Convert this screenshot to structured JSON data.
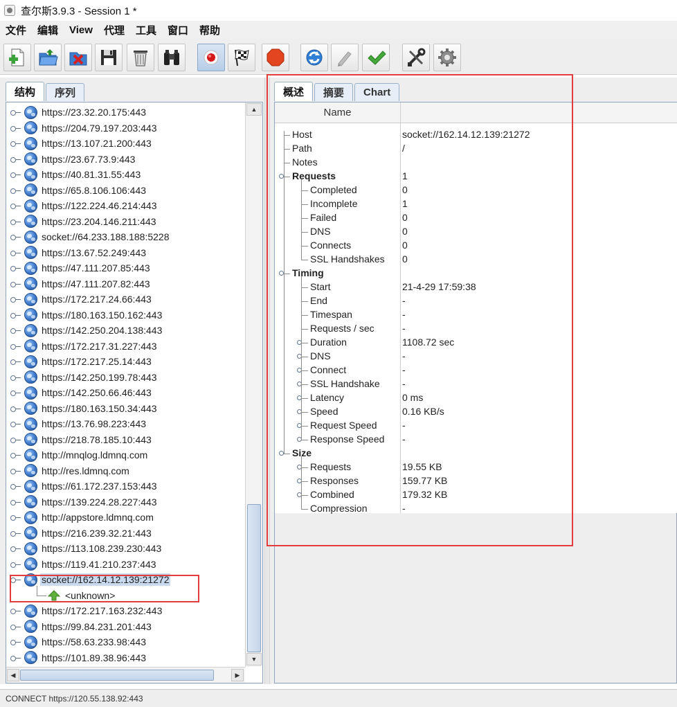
{
  "window": {
    "title": "查尔斯3.9.3 - Session 1 *"
  },
  "menu": [
    "文件",
    "编辑",
    "View",
    "代理",
    "工具",
    "窗口",
    "帮助"
  ],
  "toolbar": {
    "buttons": [
      {
        "name": "new-session-button",
        "icon": "new-session-icon"
      },
      {
        "name": "open-session-button",
        "icon": "open-folder-icon"
      },
      {
        "name": "close-session-button",
        "icon": "close-session-icon"
      },
      {
        "name": "save-session-button",
        "icon": "floppy-disk-icon"
      },
      {
        "name": "clear-session-button",
        "icon": "trash-icon"
      },
      {
        "name": "find-button",
        "icon": "binoculars-icon"
      },
      {
        "name": "record-button",
        "icon": "record-icon",
        "active": true
      },
      {
        "name": "throttle-button",
        "icon": "checkered-flag-icon"
      },
      {
        "name": "stop-button",
        "icon": "stop-sign-icon"
      },
      {
        "name": "repeat-button",
        "icon": "refresh-icon"
      },
      {
        "name": "edit-button",
        "icon": "pencil-icon"
      },
      {
        "name": "validate-button",
        "icon": "checkmark-icon"
      },
      {
        "name": "tools-button",
        "icon": "tools-icon"
      },
      {
        "name": "settings-button",
        "icon": "gear-icon"
      }
    ]
  },
  "left": {
    "tabs": [
      "结构",
      "序列"
    ],
    "selected_tab": "结构",
    "hosts": [
      "https://23.32.20.175:443",
      "https://204.79.197.203:443",
      "https://13.107.21.200:443",
      "https://23.67.73.9:443",
      "https://40.81.31.55:443",
      "https://65.8.106.106:443",
      "https://122.224.46.214:443",
      "https://23.204.146.211:443",
      "socket://64.233.188.188:5228",
      "https://13.67.52.249:443",
      "https://47.111.207.85:443",
      "https://47.111.207.82:443",
      "https://172.217.24.66:443",
      "https://180.163.150.162:443",
      "https://142.250.204.138:443",
      "https://172.217.31.227:443",
      "https://172.217.25.14:443",
      "https://142.250.199.78:443",
      "https://142.250.66.46:443",
      "https://180.163.150.34:443",
      "https://13.76.98.223:443",
      "https://218.78.185.10:443",
      "http://mnqlog.ldmnq.com",
      "http://res.ldmnq.com",
      "https://61.172.237.153:443",
      "https://139.224.28.227:443",
      "http://appstore.ldmnq.com",
      "https://216.239.32.21:443",
      "https://113.108.239.230:443",
      "https://119.41.210.237:443",
      "socket://162.14.12.139:21272",
      "https://172.217.163.232:443",
      "https://99.84.231.201:443",
      "https://58.63.233.98:443",
      "https://101.89.38.96:443"
    ],
    "selected_host": "socket://162.14.12.139:21272",
    "selected_child": "<unknown>"
  },
  "right": {
    "tabs": [
      "概述",
      "摘要",
      "Chart"
    ],
    "selected_tab": "概述",
    "column_header": "Name",
    "rows": [
      {
        "label": "Host",
        "value": "socket://162.14.12.139:21272",
        "level": 0,
        "bold": false,
        "expandable": false
      },
      {
        "label": "Path",
        "value": "/",
        "level": 0,
        "bold": false,
        "expandable": false
      },
      {
        "label": "Notes",
        "value": "",
        "level": 0,
        "bold": false,
        "expandable": false
      },
      {
        "label": "Requests",
        "value": "1",
        "level": 0,
        "bold": true,
        "expandable": true
      },
      {
        "label": "Completed",
        "value": "0",
        "level": 1,
        "bold": false,
        "expandable": false
      },
      {
        "label": "Incomplete",
        "value": "1",
        "level": 1,
        "bold": false,
        "expandable": false
      },
      {
        "label": "Failed",
        "value": "0",
        "level": 1,
        "bold": false,
        "expandable": false
      },
      {
        "label": "DNS",
        "value": "0",
        "level": 1,
        "bold": false,
        "expandable": false
      },
      {
        "label": "Connects",
        "value": "0",
        "level": 1,
        "bold": false,
        "expandable": false
      },
      {
        "label": "SSL Handshakes",
        "value": "0",
        "level": 1,
        "bold": false,
        "expandable": false
      },
      {
        "label": "Timing",
        "value": "",
        "level": 0,
        "bold": true,
        "expandable": true
      },
      {
        "label": "Start",
        "value": "21-4-29 17:59:38",
        "level": 1,
        "bold": false,
        "expandable": false
      },
      {
        "label": "End",
        "value": "-",
        "level": 1,
        "bold": false,
        "expandable": false
      },
      {
        "label": "Timespan",
        "value": "-",
        "level": 1,
        "bold": false,
        "expandable": false
      },
      {
        "label": "Requests / sec",
        "value": "-",
        "level": 1,
        "bold": false,
        "expandable": false
      },
      {
        "label": "Duration",
        "value": "1108.72 sec",
        "level": 1,
        "bold": false,
        "expandable": true
      },
      {
        "label": "DNS",
        "value": "-",
        "level": 1,
        "bold": false,
        "expandable": true
      },
      {
        "label": "Connect",
        "value": "-",
        "level": 1,
        "bold": false,
        "expandable": true
      },
      {
        "label": "SSL Handshake",
        "value": "-",
        "level": 1,
        "bold": false,
        "expandable": true
      },
      {
        "label": "Latency",
        "value": "0 ms",
        "level": 1,
        "bold": false,
        "expandable": true
      },
      {
        "label": "Speed",
        "value": "0.16 KB/s",
        "level": 1,
        "bold": false,
        "expandable": true
      },
      {
        "label": "Request Speed",
        "value": "-",
        "level": 1,
        "bold": false,
        "expandable": true
      },
      {
        "label": "Response Speed",
        "value": "-",
        "level": 1,
        "bold": false,
        "expandable": true
      },
      {
        "label": "Size",
        "value": "",
        "level": 0,
        "bold": true,
        "expandable": true
      },
      {
        "label": "Requests",
        "value": "19.55 KB",
        "level": 1,
        "bold": false,
        "expandable": true
      },
      {
        "label": "Responses",
        "value": "159.77 KB",
        "level": 1,
        "bold": false,
        "expandable": true
      },
      {
        "label": "Combined",
        "value": "179.32 KB",
        "level": 1,
        "bold": false,
        "expandable": true
      },
      {
        "label": "Compression",
        "value": "-",
        "level": 1,
        "bold": false,
        "expandable": false
      }
    ]
  },
  "status": {
    "text": "CONNECT https://120.55.138.92:443"
  },
  "colors": {
    "annotation": "#e23c3c",
    "selection": "#c9d9ee",
    "tab_border": "#9ab0c8"
  }
}
